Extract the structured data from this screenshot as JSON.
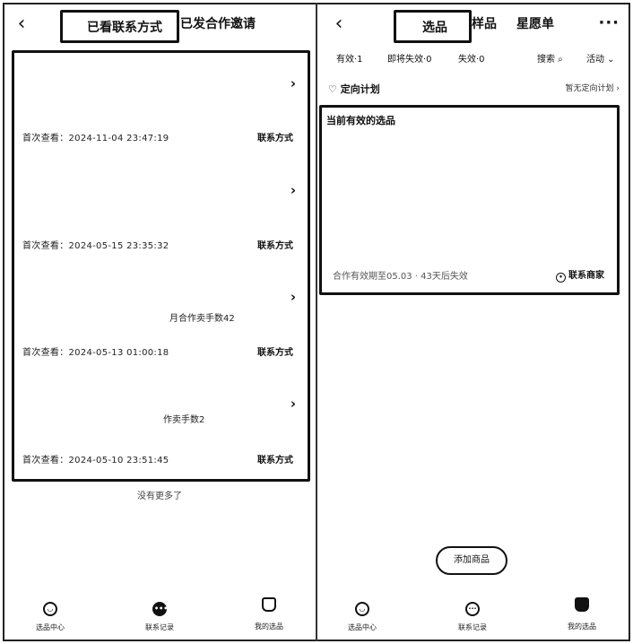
{
  "left": {
    "back_icon": "chevron-left-icon",
    "tabs": [
      "已看联系方式",
      "已发合作邀请"
    ],
    "rows": [
      {
        "note": "",
        "time": "首次查看：2024-11-04 23:47:19",
        "contact": "联系方式"
      },
      {
        "note": "",
        "time": "首次查看：2024-05-15 23:35:32",
        "contact": "联系方式"
      },
      {
        "note": "月合作卖手数42",
        "time": "首次查看：2024-05-13 01:00:18",
        "contact": "联系方式"
      },
      {
        "note": "作卖手数2",
        "time": "首次查看：2024-05-10 23:51:45",
        "contact": "联系方式"
      }
    ],
    "no_more": "没有更多了",
    "nav": [
      {
        "label": "选品中心",
        "icon": "home-icon"
      },
      {
        "label": "联系记录",
        "icon": "chat-icon"
      },
      {
        "label": "我的选品",
        "icon": "cart-icon"
      }
    ]
  },
  "right": {
    "back_icon": "chevron-left-icon",
    "tabs": [
      "选品",
      "样品",
      "星愿单"
    ],
    "more": "···",
    "filters": {
      "valid": "有效·1",
      "expiring": "即将失效·0",
      "invalid": "失效·0",
      "search": "搜索 ⌕",
      "activity": "活动 ⌄"
    },
    "plan": {
      "title": "♡ 定向计划",
      "link": "暂无定向计划 ›"
    },
    "card": {
      "title": "当前有效的选品",
      "expire": "合作有效期至05.03 · 43天后失效",
      "contact": "联系商家"
    },
    "float_button": "添加商品",
    "nav": [
      {
        "label": "选品中心",
        "icon": "home-icon"
      },
      {
        "label": "联系记录",
        "icon": "chat-icon"
      },
      {
        "label": "我的选品",
        "icon": "cart-icon"
      }
    ]
  }
}
